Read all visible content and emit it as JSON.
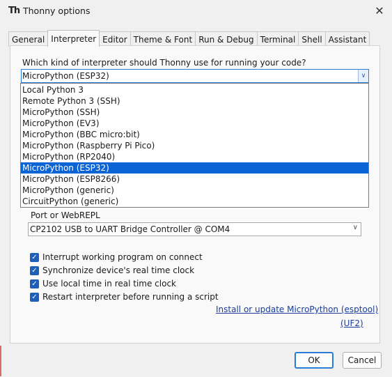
{
  "window": {
    "title": "Thonny options",
    "app_icon": "Th"
  },
  "tabs": [
    {
      "label": "General",
      "active": false
    },
    {
      "label": "Interpreter",
      "active": true
    },
    {
      "label": "Editor",
      "active": false
    },
    {
      "label": "Theme & Font",
      "active": false
    },
    {
      "label": "Run & Debug",
      "active": false
    },
    {
      "label": "Terminal",
      "active": false
    },
    {
      "label": "Shell",
      "active": false
    },
    {
      "label": "Assistant",
      "active": false
    }
  ],
  "interpreter": {
    "prompt": "Which kind of interpreter should Thonny use for running your code?",
    "selected": "MicroPython (ESP32)",
    "options": [
      "Local Python 3",
      "Remote Python 3 (SSH)",
      "MicroPython (SSH)",
      "MicroPython (EV3)",
      "MicroPython (BBC micro:bit)",
      "MicroPython (Raspberry Pi Pico)",
      "MicroPython (RP2040)",
      "MicroPython (ESP32)",
      "MicroPython (ESP8266)",
      "MicroPython (generic)",
      "CircuitPython (generic)"
    ],
    "selected_index": 7
  },
  "port": {
    "label": "Port or WebREPL",
    "value": "CP2102 USB to UART Bridge Controller @ COM4"
  },
  "checkboxes": [
    {
      "label": "Interrupt working program on connect",
      "checked": true
    },
    {
      "label": "Synchronize device's real time clock",
      "checked": true
    },
    {
      "label": "Use local time in real time clock",
      "checked": true
    },
    {
      "label": "Restart interpreter before running a script",
      "checked": true
    }
  ],
  "links": {
    "install": "Install or update MicroPython (esptool)",
    "uf2": "(UF2)"
  },
  "buttons": {
    "ok": "OK",
    "cancel": "Cancel"
  },
  "icons": {
    "app": "thonny-icon",
    "close": "close-icon",
    "dropdown": "chevron-down-icon",
    "check": "checkmark-icon"
  }
}
